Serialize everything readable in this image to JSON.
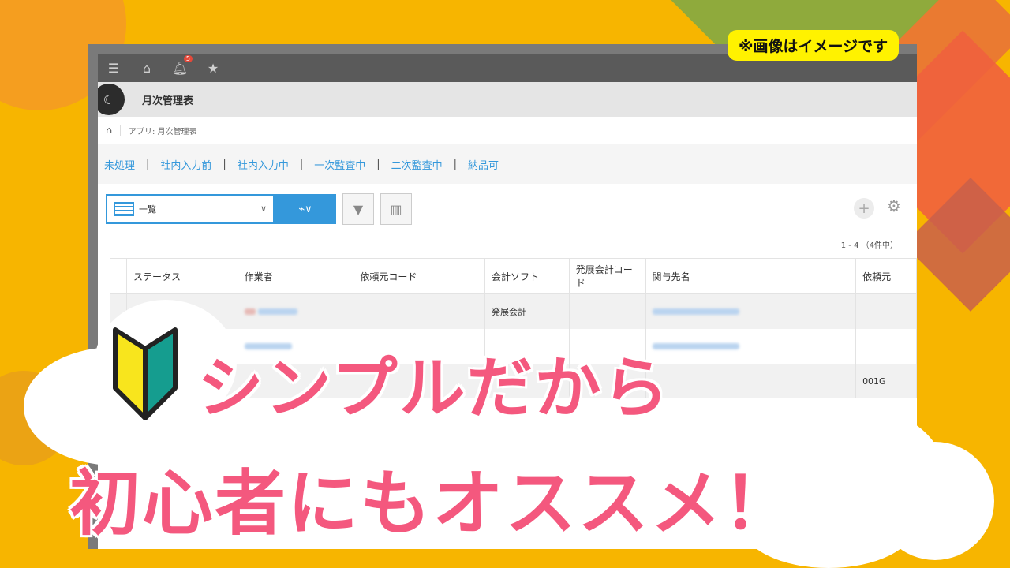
{
  "notice": "※画像はイメージです",
  "topbar": {
    "notification_count": "5",
    "icons": [
      "menu-icon",
      "home-icon",
      "bell-icon",
      "star-icon"
    ]
  },
  "app": {
    "title": "月次管理表",
    "breadcrumb": "アプリ: 月次管理表"
  },
  "filters": [
    "未処理",
    "社内入力前",
    "社内入力中",
    "一次監査中",
    "二次監査中",
    "納品可"
  ],
  "toolbar": {
    "view_label": "一覧"
  },
  "pagination": "1 - 4 （4件中）",
  "table": {
    "columns": [
      "ステータス",
      "作業者",
      "依頼元コード",
      "会計ソフト",
      "発展会計コード",
      "関与先名",
      "依頼元"
    ],
    "rows": [
      [
        "",
        "",
        "",
        "発展会計",
        "",
        "",
        ""
      ],
      [
        "",
        "",
        "",
        "",
        "",
        "",
        ""
      ],
      [
        "",
        "",
        "",
        "",
        "",
        "",
        "001G"
      ]
    ]
  },
  "headline": {
    "line1": "シンプルだから",
    "line2": "初心者にもオススメ！"
  }
}
